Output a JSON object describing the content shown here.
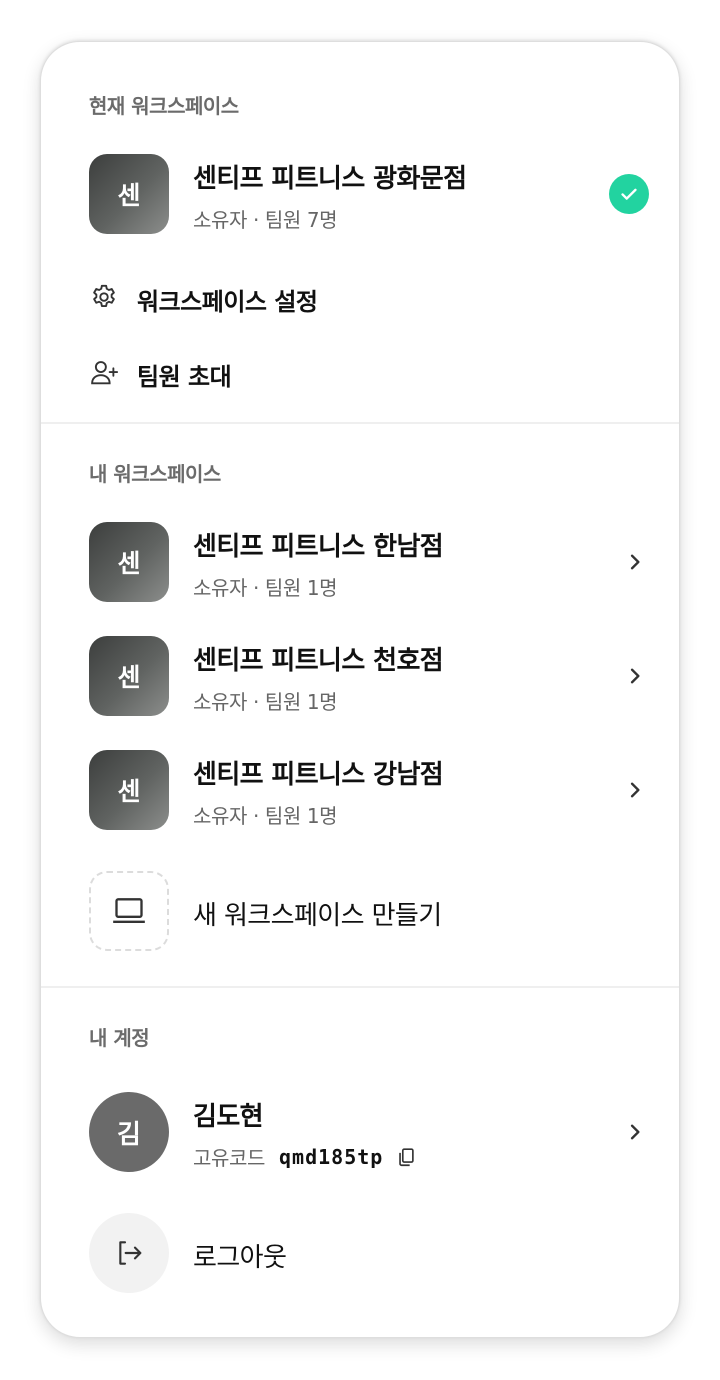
{
  "current_section": {
    "label": "현재 워크스페이스",
    "workspace": {
      "avatar": "센",
      "name": "센티프 피트니스 광화문점",
      "meta": "소유자 · 팀원 7명",
      "selected_icon": "check-icon",
      "accent": "#22d3a0"
    },
    "menu": [
      {
        "icon": "gear-icon",
        "label": "워크스페이스 설정"
      },
      {
        "icon": "user-plus-icon",
        "label": "팀원 초대"
      }
    ]
  },
  "my_workspaces": {
    "label": "내 워크스페이스",
    "items": [
      {
        "avatar": "센",
        "name": "센티프 피트니스 한남점",
        "meta": "소유자 · 팀원 1명"
      },
      {
        "avatar": "센",
        "name": "센티프 피트니스 천호점",
        "meta": "소유자 · 팀원 1명"
      },
      {
        "avatar": "센",
        "name": "센티프 피트니스 강남점",
        "meta": "소유자 · 팀원 1명"
      }
    ],
    "create": {
      "icon": "laptop-icon",
      "label": "새 워크스페이스 만들기"
    }
  },
  "account": {
    "label": "내 계정",
    "user": {
      "avatar": "김",
      "name": "김도현",
      "code_label": "고유코드",
      "code_value": "qmd185tp",
      "copy_icon": "copy-icon"
    },
    "logout": {
      "icon": "logout-icon",
      "label": "로그아웃"
    }
  }
}
